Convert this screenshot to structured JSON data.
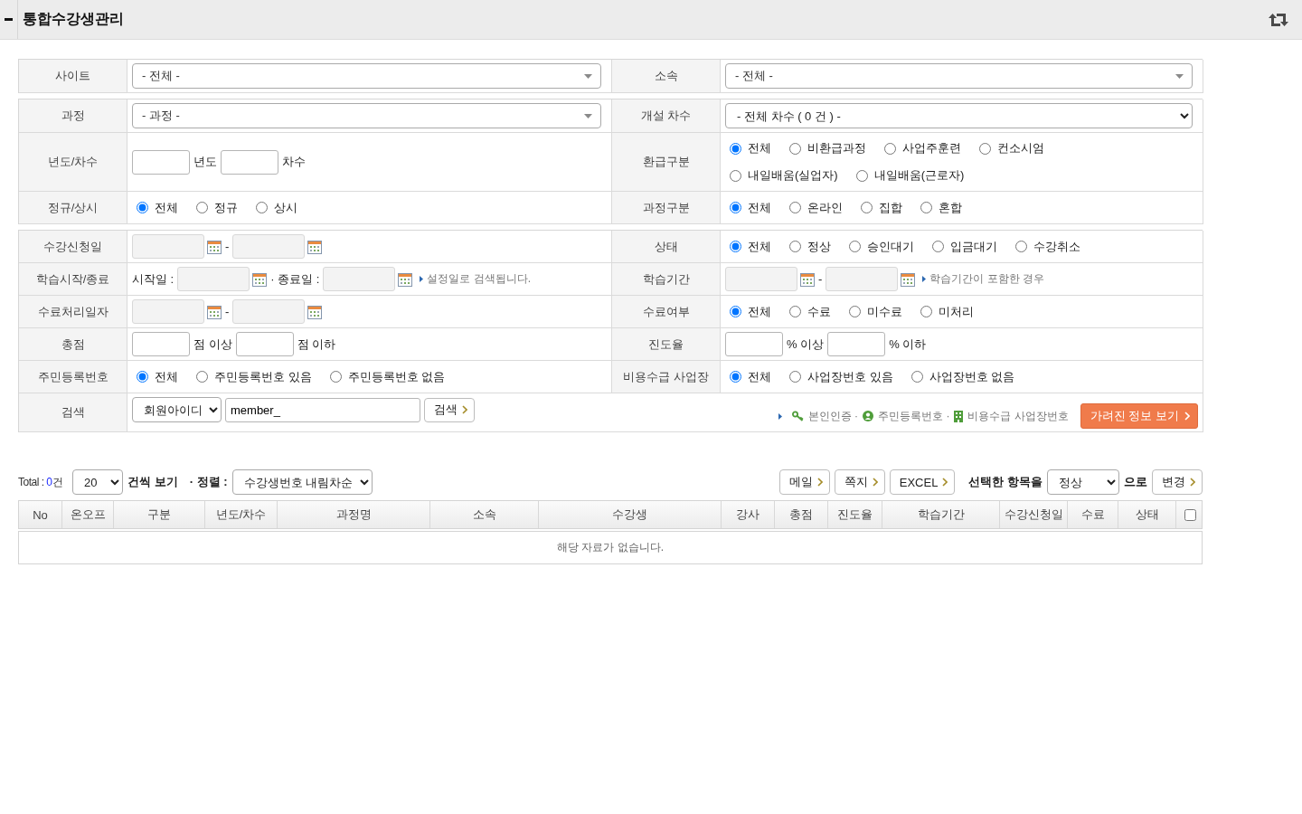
{
  "header": {
    "title": "통합수강생관리"
  },
  "filter_groups": [
    {
      "rows": [
        {
          "cells": [
            {
              "label": "사이트",
              "parts": [
                {
                  "kind": "combo",
                  "value": "- 전체 -"
                }
              ]
            },
            {
              "label": "소속",
              "parts": [
                {
                  "kind": "combo",
                  "value": "- 전체 -"
                }
              ]
            }
          ]
        }
      ]
    },
    {
      "rows": [
        {
          "cells": [
            {
              "label": "과정",
              "parts": [
                {
                  "kind": "combo",
                  "value": "- 과정 -"
                }
              ]
            },
            {
              "label": "개설 차수",
              "parts": [
                {
                  "kind": "wideselect",
                  "value": "- 전체 차수 ( 0 건 ) -"
                }
              ]
            }
          ]
        },
        {
          "cells": [
            {
              "label": "년도/차수",
              "parts": [
                {
                  "kind": "input"
                },
                {
                  "kind": "text",
                  "text": "년도"
                },
                {
                  "kind": "input"
                },
                {
                  "kind": "text",
                  "text": "차수"
                }
              ]
            },
            {
              "label": "환급구분",
              "parts": [
                {
                  "kind": "radios",
                  "options": [
                    {
                      "label": "전체",
                      "selected": true
                    },
                    {
                      "label": "비환급과정",
                      "selected": false
                    },
                    {
                      "label": "사업주훈련",
                      "selected": false
                    },
                    {
                      "label": "컨소시엄",
                      "selected": false
                    }
                  ]
                },
                {
                  "kind": "radios",
                  "options": [
                    {
                      "label": "내일배움(실업자)",
                      "selected": false
                    },
                    {
                      "label": "내일배움(근로자)",
                      "selected": false
                    }
                  ]
                }
              ]
            }
          ]
        },
        {
          "cells": [
            {
              "label": "정규/상시",
              "parts": [
                {
                  "kind": "radios",
                  "options": [
                    {
                      "label": "전체",
                      "selected": true
                    },
                    {
                      "label": "정규",
                      "selected": false
                    },
                    {
                      "label": "상시",
                      "selected": false
                    }
                  ]
                }
              ]
            },
            {
              "label": "과정구분",
              "parts": [
                {
                  "kind": "radios",
                  "options": [
                    {
                      "label": "전체",
                      "selected": true
                    },
                    {
                      "label": "온라인",
                      "selected": false
                    },
                    {
                      "label": "집합",
                      "selected": false
                    },
                    {
                      "label": "혼합",
                      "selected": false
                    }
                  ]
                }
              ]
            }
          ]
        }
      ]
    },
    {
      "rows": [
        {
          "cells": [
            {
              "label": "수강신청일",
              "parts": [
                {
                  "kind": "date",
                  "disabled": true
                },
                {
                  "kind": "text",
                  "text": "-"
                },
                {
                  "kind": "date",
                  "disabled": true
                }
              ]
            },
            {
              "label": "상태",
              "parts": [
                {
                  "kind": "radios",
                  "options": [
                    {
                      "label": "전체",
                      "selected": true
                    },
                    {
                      "label": "정상",
                      "selected": false
                    },
                    {
                      "label": "승인대기",
                      "selected": false
                    },
                    {
                      "label": "입금대기",
                      "selected": false
                    },
                    {
                      "label": "수강취소",
                      "selected": false
                    }
                  ]
                }
              ]
            }
          ]
        },
        {
          "cells": [
            {
              "label": "학습시작/종료",
              "parts": [
                {
                  "kind": "text",
                  "text": "시작일 :"
                },
                {
                  "kind": "date",
                  "disabled": true
                },
                {
                  "kind": "text",
                  "text": "· 종료일 :"
                },
                {
                  "kind": "date",
                  "disabled": true
                },
                {
                  "kind": "hint",
                  "text": "설정일로 검색됩니다."
                }
              ]
            },
            {
              "label": "학습기간",
              "parts": [
                {
                  "kind": "date",
                  "disabled": true
                },
                {
                  "kind": "text",
                  "text": "-"
                },
                {
                  "kind": "date",
                  "disabled": true
                },
                {
                  "kind": "hint",
                  "text": "학습기간이 포함한 경우"
                }
              ]
            }
          ]
        },
        {
          "cells": [
            {
              "label": "수료처리일자",
              "parts": [
                {
                  "kind": "date",
                  "disabled": true
                },
                {
                  "kind": "text",
                  "text": "-"
                },
                {
                  "kind": "date",
                  "disabled": true
                }
              ]
            },
            {
              "label": "수료여부",
              "parts": [
                {
                  "kind": "radios",
                  "options": [
                    {
                      "label": "전체",
                      "selected": true
                    },
                    {
                      "label": "수료",
                      "selected": false
                    },
                    {
                      "label": "미수료",
                      "selected": false
                    },
                    {
                      "label": "미처리",
                      "selected": false
                    }
                  ]
                }
              ]
            }
          ]
        },
        {
          "cells": [
            {
              "label": "총점",
              "parts": [
                {
                  "kind": "input"
                },
                {
                  "kind": "text",
                  "text": "점 이상"
                },
                {
                  "kind": "input"
                },
                {
                  "kind": "text",
                  "text": "점 이하"
                }
              ]
            },
            {
              "label": "진도율",
              "parts": [
                {
                  "kind": "input"
                },
                {
                  "kind": "text",
                  "text": "% 이상"
                },
                {
                  "kind": "input"
                },
                {
                  "kind": "text",
                  "text": "% 이하"
                }
              ]
            }
          ]
        },
        {
          "cells": [
            {
              "label": "주민등록번호",
              "parts": [
                {
                  "kind": "radios",
                  "options": [
                    {
                      "label": "전체",
                      "selected": true
                    },
                    {
                      "label": "주민등록번호 있음",
                      "selected": false
                    },
                    {
                      "label": "주민등록번호 없음",
                      "selected": false
                    }
                  ]
                }
              ]
            },
            {
              "label": "비용수급 사업장",
              "parts": [
                {
                  "kind": "radios",
                  "options": [
                    {
                      "label": "전체",
                      "selected": true
                    },
                    {
                      "label": "사업장번호 있음",
                      "selected": false
                    },
                    {
                      "label": "사업장번호 없음",
                      "selected": false
                    }
                  ]
                }
              ]
            }
          ]
        },
        {
          "cells": [
            {
              "label": "검색",
              "parts": [
                {
                  "kind": "select",
                  "value": "회원아이디"
                },
                {
                  "kind": "query",
                  "value": "member_"
                },
                {
                  "kind": "button",
                  "label": "검색"
                }
              ],
              "aside": {
                "legend": [
                  {
                    "kind": "verify",
                    "text": "본인인증 ·"
                  },
                  {
                    "kind": "resident",
                    "text": "주민등록번호 ·"
                  },
                  {
                    "kind": "business",
                    "text": "비용수급 사업장번호"
                  }
                ],
                "button": "가려진 정보 보기"
              }
            }
          ]
        }
      ]
    }
  ],
  "list_toolbar": {
    "total": {
      "label": "Total :",
      "count": "0",
      "unit": "건"
    },
    "page_size": "20",
    "page_size_label": "건씩 보기",
    "sort_label": "· 정렬 :",
    "sort": "수강생번호 내림차순",
    "actions": [
      "메일",
      "쪽지",
      "EXCEL"
    ],
    "bulk_label": "선택한 항목을",
    "bulk_status": "정상",
    "bulk_suffix": "으로",
    "apply_button": "변경"
  },
  "table": {
    "columns": [
      "No",
      "온오프",
      "구분",
      "년도/차수",
      "과정명",
      "소속",
      "수강생",
      "강사",
      "총점",
      "진도율",
      "학습기간",
      "수강신청일",
      "수료",
      "상태"
    ],
    "select_all": {
      "checked": false
    },
    "empty_message": "해당 자료가 없습니다."
  }
}
